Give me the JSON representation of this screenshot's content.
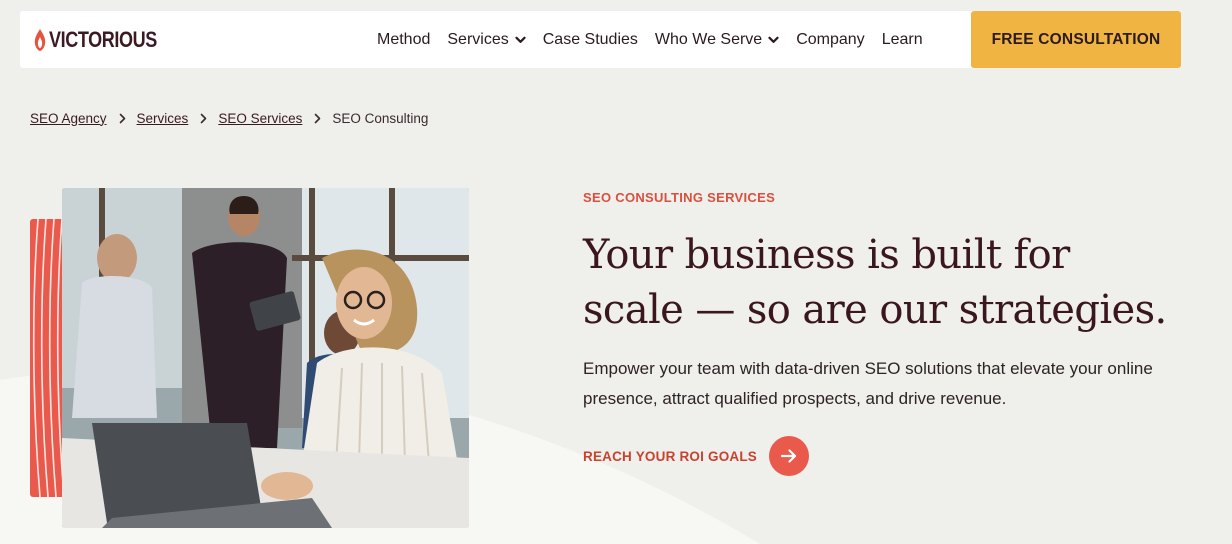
{
  "brand": {
    "name": "VICTORIOUS",
    "accent_color": "#ea5a4c",
    "cta_color": "#f0b443"
  },
  "nav": {
    "items": [
      {
        "label": "Method",
        "has_dropdown": false
      },
      {
        "label": "Services",
        "has_dropdown": true
      },
      {
        "label": "Case Studies",
        "has_dropdown": false
      },
      {
        "label": "Who We Serve",
        "has_dropdown": true
      },
      {
        "label": "Company",
        "has_dropdown": false
      },
      {
        "label": "Learn",
        "has_dropdown": false
      }
    ],
    "cta_label": "FREE CONSULTATION"
  },
  "breadcrumb": {
    "links": [
      "SEO Agency",
      "Services",
      "SEO Services"
    ],
    "current": "SEO Consulting"
  },
  "hero": {
    "eyebrow": "SEO CONSULTING SERVICES",
    "headline_line1": "Your business is built for",
    "headline_line2": "scale — so are our strategies.",
    "lede": "Empower your team with data-driven SEO solutions that elevate your online presence, attract qualified prospects, and drive revenue.",
    "link_label": "REACH YOUR ROI GOALS",
    "image_icon": "team-meeting-photo"
  }
}
